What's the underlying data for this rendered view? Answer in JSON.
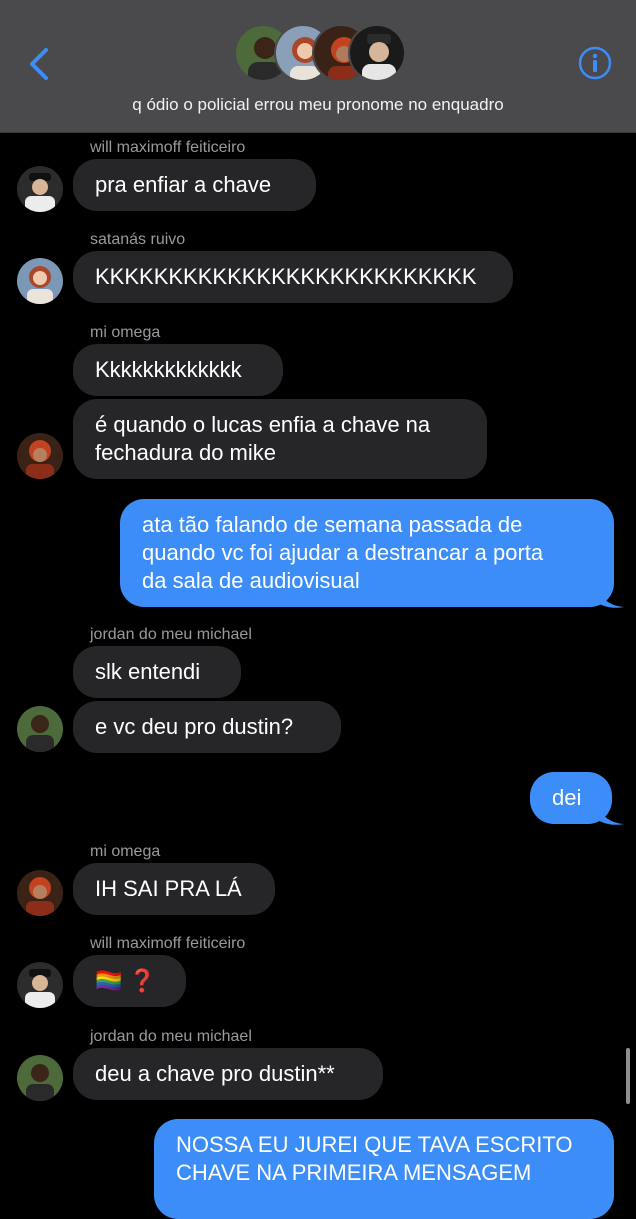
{
  "header": {
    "group_name": "q ódio o policial errou meu pronome no enquadro",
    "back_icon": "chevron-left-icon",
    "info_icon": "info-circle-icon",
    "accent": "#3c8df7"
  },
  "messages": [
    {
      "sender": "will maximoff feiticeiro",
      "text": "pra enfiar a chave"
    },
    {
      "sender": "satanás ruivo",
      "text": "KKKKKKKKKKKKKKKKKKKKKKKKKK"
    },
    {
      "sender": "mi omega",
      "text": "Kkkkkkkkkkkkk"
    },
    {
      "text_line1": "é quando o lucas enfia a chave na",
      "text_line2": "fechadura do mike"
    },
    {
      "text_line1": "ata tão falando de semana passada de",
      "text_line2": "quando vc foi ajudar a destrancar a porta",
      "text_line3": "da sala de audiovisual"
    },
    {
      "sender": "jordan do meu michael",
      "text": "slk entendi"
    },
    {
      "text": "e vc deu pro dustin?"
    },
    {
      "text": "dei"
    },
    {
      "sender": "mi omega",
      "text": "IH SAI PRA LÁ"
    },
    {
      "sender": "will maximoff feiticeiro",
      "text": "🏳️‍🌈 ❓"
    },
    {
      "sender": "jordan do meu michael",
      "text": "deu a chave pro dustin**"
    },
    {
      "text_line1": "NOSSA EU JUREI QUE TAVA ESCRITO",
      "text_line2": "CHAVE NA PRIMEIRA MENSAGEM"
    }
  ],
  "colors": {
    "incoming_bubble": "#262629",
    "outgoing_bubble": "#3c8df7",
    "header_bg": "#4a4a4c"
  }
}
